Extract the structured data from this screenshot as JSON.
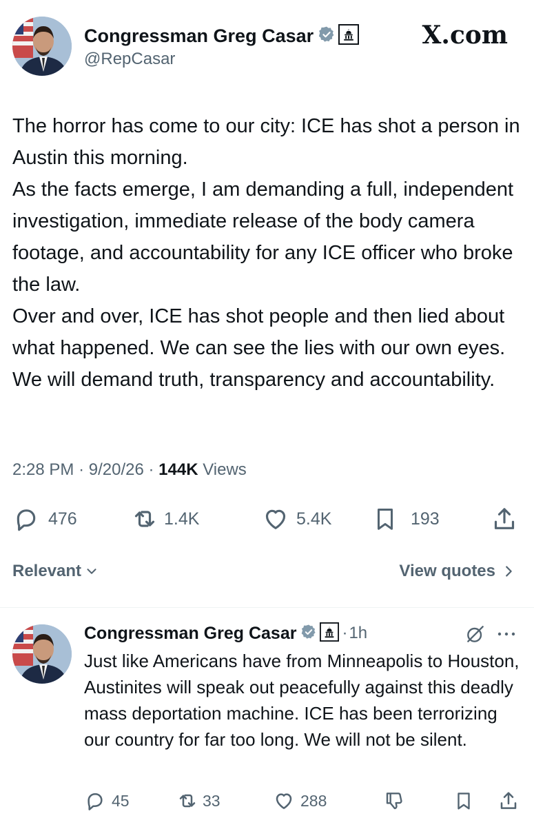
{
  "brand": "X.com",
  "main_post": {
    "author_name": "Congressman Greg Casar",
    "handle": "@RepCasar",
    "paragraphs": [
      "The horror has come to our city: ICE has shot a person in Austin this morning.",
      "As the facts emerge, I am demanding a full, independent investigation, immediate release of the body camera footage, and accountability for any ICE officer who broke the law.",
      "Over and over, ICE has shot people and then lied about what happened. We can see the lies with our own eyes. We will demand truth, transparency and accountability."
    ],
    "time": "2:28 PM",
    "date": "9/20/26",
    "views_count": "144K",
    "views_label": "Views",
    "replies": "476",
    "reposts": "1.4K",
    "likes": "5.4K",
    "bookmarks": "193"
  },
  "sort": {
    "label": "Relevant",
    "view_quotes": "View quotes"
  },
  "reply_post": {
    "author_name": "Congressman Greg Casar",
    "time_ago": "1h",
    "text": "Just like Americans have from Minneapolis to Houston, Austinites will speak out peacefully against this deadly mass deportation machine. ICE has been terrorizing our country for far too long. We will not be silent.",
    "replies": "45",
    "reposts": "33",
    "likes": "288"
  },
  "colors": {
    "text": "#0f1419",
    "secondary": "#536471",
    "verified": "#829aab",
    "divider": "#eff3f4"
  },
  "icons": [
    "verified-badge-icon",
    "government-badge-icon",
    "reply-icon",
    "repost-icon",
    "like-icon",
    "bookmark-icon",
    "share-icon",
    "chevron-down-icon",
    "chevron-right-icon",
    "grok-icon",
    "more-icon"
  ]
}
